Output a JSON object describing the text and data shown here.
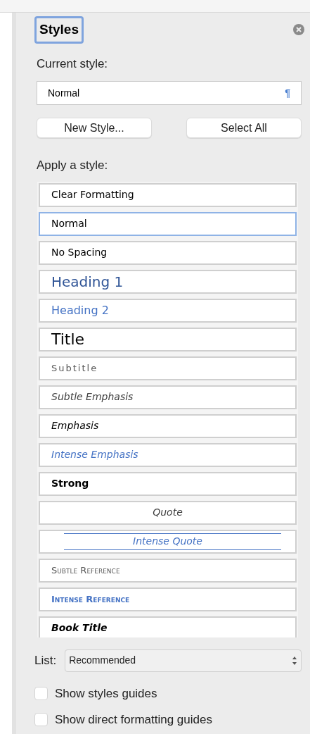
{
  "panel": {
    "title": "Styles",
    "focused": true
  },
  "current_style": {
    "label": "Current style:",
    "value": "Normal",
    "mark": "¶"
  },
  "buttons": [
    "New Style...",
    "Select All"
  ],
  "apply_label": "Apply a style:",
  "styles": [
    {
      "name": "Clear Formatting",
      "kind": "clear",
      "selected": false
    },
    {
      "name": "Normal",
      "kind": "normal",
      "selected": true
    },
    {
      "name": "No Spacing",
      "kind": "normal",
      "selected": false
    },
    {
      "name": "Heading 1",
      "kind": "heading1",
      "selected": false
    },
    {
      "name": "Heading 2",
      "kind": "heading2",
      "selected": false
    },
    {
      "name": "Title",
      "kind": "title",
      "selected": false
    },
    {
      "name": "Subtitle",
      "kind": "subtitle",
      "selected": false
    },
    {
      "name": "Subtle Emphasis",
      "kind": "subtle-emphasis",
      "selected": false
    },
    {
      "name": "Emphasis",
      "kind": "emphasis",
      "selected": false
    },
    {
      "name": "Intense Emphasis",
      "kind": "intense-emphasis",
      "selected": false
    },
    {
      "name": "Strong",
      "kind": "strong",
      "selected": false
    },
    {
      "name": "Quote",
      "kind": "quote",
      "selected": false
    },
    {
      "name": "Intense Quote",
      "kind": "intense-quote",
      "selected": false
    },
    {
      "name": "Subtle Reference",
      "kind": "subtle-reference",
      "selected": false
    },
    {
      "name": "Intense Reference",
      "kind": "intense-reference",
      "selected": false
    },
    {
      "name": "Book Title",
      "kind": "book-title",
      "selected": false
    }
  ],
  "list": {
    "label": "List:",
    "value": "Recommended"
  },
  "options": [
    {
      "label": "Show styles guides",
      "checked": false
    },
    {
      "label": "Show direct formatting guides",
      "checked": false
    }
  ]
}
